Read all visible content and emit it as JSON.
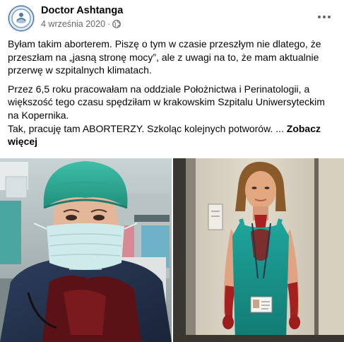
{
  "post": {
    "author": "Doctor Ashtanga",
    "date": "4 września 2020",
    "separator": "·",
    "privacy_icon": "globe-icon",
    "more_icon": "more-options-icon",
    "paragraphs": [
      "Byłam takim aborterem. Piszę o tym w czasie przeszłym nie dlatego, że przeszłam na „jasną stronę mocy”, ale z uwagi na to, że mam aktualnie przerwę w szpitalnych klimatach.",
      "Przez 6,5 roku pracowałam na oddziale Położnictwa i Perinatologii, a większość tego czasu spędziłam w krakowskim Szpitalu Uniwersyteckim na Kopernika."
    ],
    "last_line": "Tak, pracuję tam ABORTERZY. Szkoląc kolejnych potworów. ...",
    "see_more": "Zobacz więcej",
    "colors": {
      "text": "#050505",
      "secondary": "#65676b",
      "background": "#ffffff"
    }
  }
}
